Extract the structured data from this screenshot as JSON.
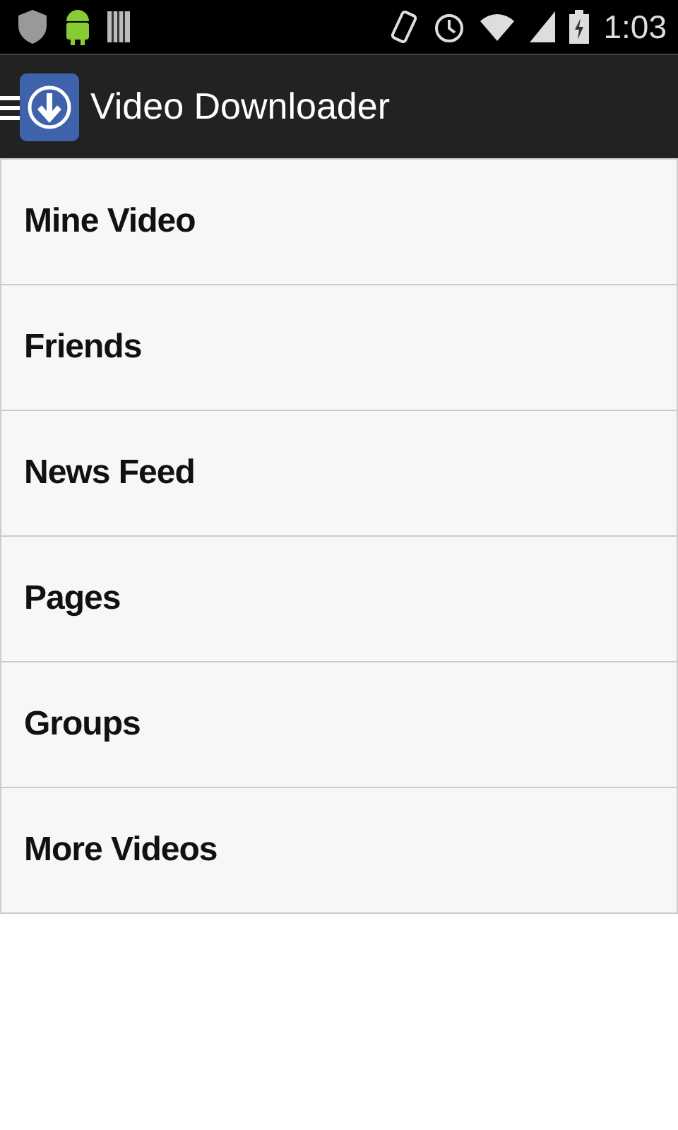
{
  "status_bar": {
    "time": "1:03"
  },
  "app_bar": {
    "title": "Video Downloader"
  },
  "menu": [
    {
      "label": "Mine Video"
    },
    {
      "label": "Friends"
    },
    {
      "label": "News Feed"
    },
    {
      "label": "Pages"
    },
    {
      "label": "Groups"
    },
    {
      "label": "More Videos"
    }
  ]
}
